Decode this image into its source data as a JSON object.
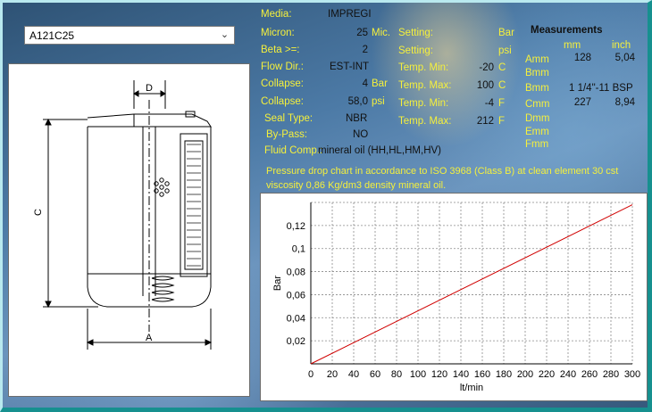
{
  "selector": {
    "value": "A121C25"
  },
  "drawing": {
    "label_d": "D",
    "label_c": "C",
    "label_a": "A"
  },
  "specs": {
    "media": {
      "label": "Media:",
      "value": "IMPREGI"
    },
    "micron": {
      "label": "Micron:",
      "value": "25",
      "unit": "Mic."
    },
    "beta": {
      "label": "Beta >=:",
      "value": "2"
    },
    "flow": {
      "label": "Flow Dir.:",
      "value": "EST-INT"
    },
    "collapse1": {
      "label": "Collapse:",
      "value": "4",
      "unit": "Bar"
    },
    "collapse2": {
      "label": "Collapse:",
      "value": "58,0",
      "unit": "psi"
    },
    "seal": {
      "label": "Seal Type:",
      "value": "NBR"
    },
    "bypass": {
      "label": "By-Pass:",
      "value": "NO"
    },
    "fluid": {
      "label": "Fluid Comp.:",
      "value": "mineral oil (HH,HL,HM,HV)"
    }
  },
  "settings": {
    "setting_bar": {
      "label": "Setting:",
      "unit": "Bar"
    },
    "setting_psi": {
      "label": "Setting:",
      "unit": "psi"
    },
    "tmin_c": {
      "label": "Temp. Min:",
      "value": "-20",
      "unit": "C"
    },
    "tmax_c": {
      "label": "Temp. Max:",
      "value": "100",
      "unit": "C"
    },
    "tmin_f": {
      "label": "Temp. Min:",
      "value": "-4",
      "unit": "F"
    },
    "tmax_f": {
      "label": "Temp. Max:",
      "value": "212",
      "unit": "F"
    }
  },
  "measurements": {
    "title": "Measurements",
    "col_mm": "mm",
    "col_inch": "inch",
    "rows": [
      {
        "label": "Amm",
        "mm": "128",
        "inch": "5,04"
      },
      {
        "label": "Bmm",
        "mm": "",
        "inch": ""
      },
      {
        "label": "Bmm",
        "mm": "1 1/4\"-11 BSP",
        "inch": ""
      },
      {
        "label": "Cmm",
        "mm": "227",
        "inch": "8,94"
      },
      {
        "label": "Dmm",
        "mm": "",
        "inch": ""
      },
      {
        "label": "Emm",
        "mm": "",
        "inch": ""
      },
      {
        "label": "Fmm",
        "mm": "",
        "inch": ""
      }
    ]
  },
  "chart_note": "Pressure drop chart in accordance to ISO 3968 (Class B) at clean element 30 cst viscosity 0,86 Kg/dm3 density mineral oil.",
  "chart_data": {
    "type": "line",
    "xlabel": "lt/min",
    "ylabel": "Bar",
    "xlim": [
      0,
      300
    ],
    "ylim": [
      0,
      0.14
    ],
    "xticks": [
      0,
      20,
      40,
      60,
      80,
      100,
      120,
      140,
      160,
      180,
      200,
      220,
      240,
      260,
      280,
      300
    ],
    "yticks": [
      0.02,
      0.04,
      0.06,
      0.08,
      0.1,
      0.12
    ],
    "ytick_labels": [
      "0,02",
      "0,04",
      "0,06",
      "0,08",
      "0,1",
      "0,12"
    ],
    "grid": true,
    "series": [
      {
        "x": [
          0,
          300
        ],
        "y": [
          0,
          0.138
        ],
        "color": "#d00000"
      }
    ]
  }
}
